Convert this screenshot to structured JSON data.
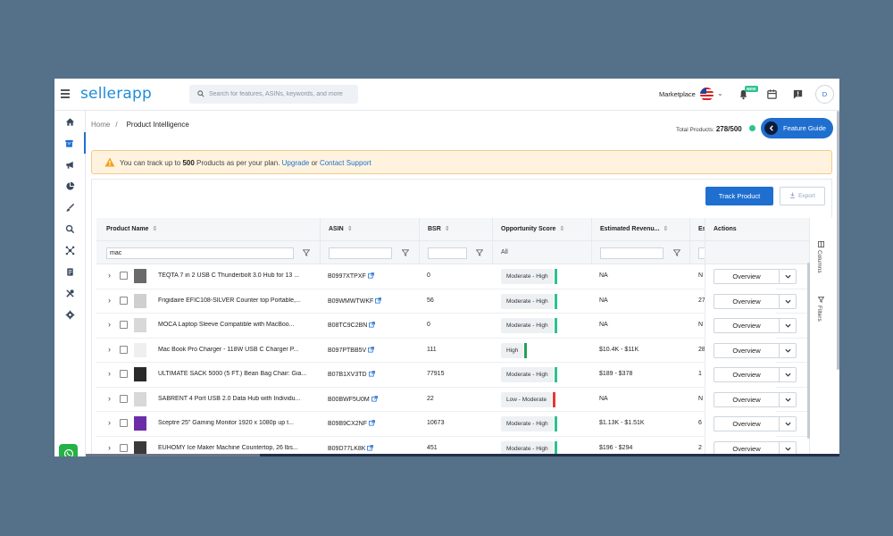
{
  "header": {
    "logo": "sellerapp",
    "search_placeholder": "Search for features, ASINs, keywords, and more",
    "marketplace_label": "Marketplace",
    "new_badge": "NEW",
    "avatar_initial": "D"
  },
  "breadcrumb": {
    "home": "Home",
    "separator": "/",
    "current": "Product Intelligence"
  },
  "total_products": {
    "label": "Total Products:",
    "value": "278/500"
  },
  "feature_guide_label": "Feature Guide",
  "alert": {
    "prefix": "You can track up to",
    "limit": "500",
    "middle": "Products as per your plan.",
    "upgrade": "Upgrade",
    "or": "or",
    "contact": "Contact Support"
  },
  "toolbar": {
    "track_label": "Track Product",
    "export_label": "Export"
  },
  "table": {
    "headers": {
      "product_name": "Product Name",
      "asin": "ASIN",
      "bsr": "BSR",
      "opportunity": "Opportunity Score",
      "revenue": "Estimated Revenu...",
      "est_short": "Es",
      "actions": "Actions"
    },
    "filters": {
      "product_name_value": "mac",
      "opportunity_value": "All"
    },
    "rows": [
      {
        "name": "TEQTA 7 in 2 USB C Thunderbolt 3.0 Hub for 13 ...",
        "asin": "B0997XTPXF",
        "bsr": "0",
        "opp": "Moderate - High",
        "rev": "NA",
        "est": "N"
      },
      {
        "name": "Frigidaire EFIC108-SILVER Counter top Portable,...",
        "asin": "B09WMWTWKF",
        "bsr": "56",
        "opp": "Moderate - High",
        "rev": "NA",
        "est": "27"
      },
      {
        "name": "MOCA Laptop Sleeve Compatible with MacBoo...",
        "asin": "B08TC9C2BN",
        "bsr": "0",
        "opp": "Moderate - High",
        "rev": "NA",
        "est": "N"
      },
      {
        "name": "Mac Book Pro Charger - 118W USB C Charger P...",
        "asin": "B097PTBB5V",
        "bsr": "111",
        "opp": "High",
        "rev": "$10.4K - $11K",
        "est": "28"
      },
      {
        "name": "ULTIMATE SACK 5000 (5 FT.) Bean Bag Chair: Gia...",
        "asin": "B07B1XV3TD",
        "bsr": "77915",
        "opp": "Moderate - High",
        "rev": "$189 - $378",
        "est": "1"
      },
      {
        "name": "SABRENT 4 Port USB 2.0 Data Hub with Individu...",
        "asin": "B00BWF5U0M",
        "bsr": "22",
        "opp": "Low - Moderate",
        "rev": "NA",
        "est": "N"
      },
      {
        "name": "Sceptre 25\" Gaming Monitor 1920 x 1080p up t...",
        "asin": "B09B9CX2NF",
        "bsr": "10673",
        "opp": "Moderate - High",
        "rev": "$1.13K - $1.51K",
        "est": "6"
      },
      {
        "name": "EUHOMY Ice Maker Machine Countertop, 26 lbs...",
        "asin": "B09D77LK8K",
        "bsr": "451",
        "opp": "Moderate - High",
        "rev": "$196 - $294",
        "est": "2"
      }
    ],
    "overview_label": "Overview"
  },
  "side_panel": {
    "columns": "Columns",
    "filters": "Filters"
  },
  "colors": {
    "accent": "#1f6fd0",
    "high": "#2cc38d",
    "low": "#e53935",
    "background": "#557089"
  }
}
